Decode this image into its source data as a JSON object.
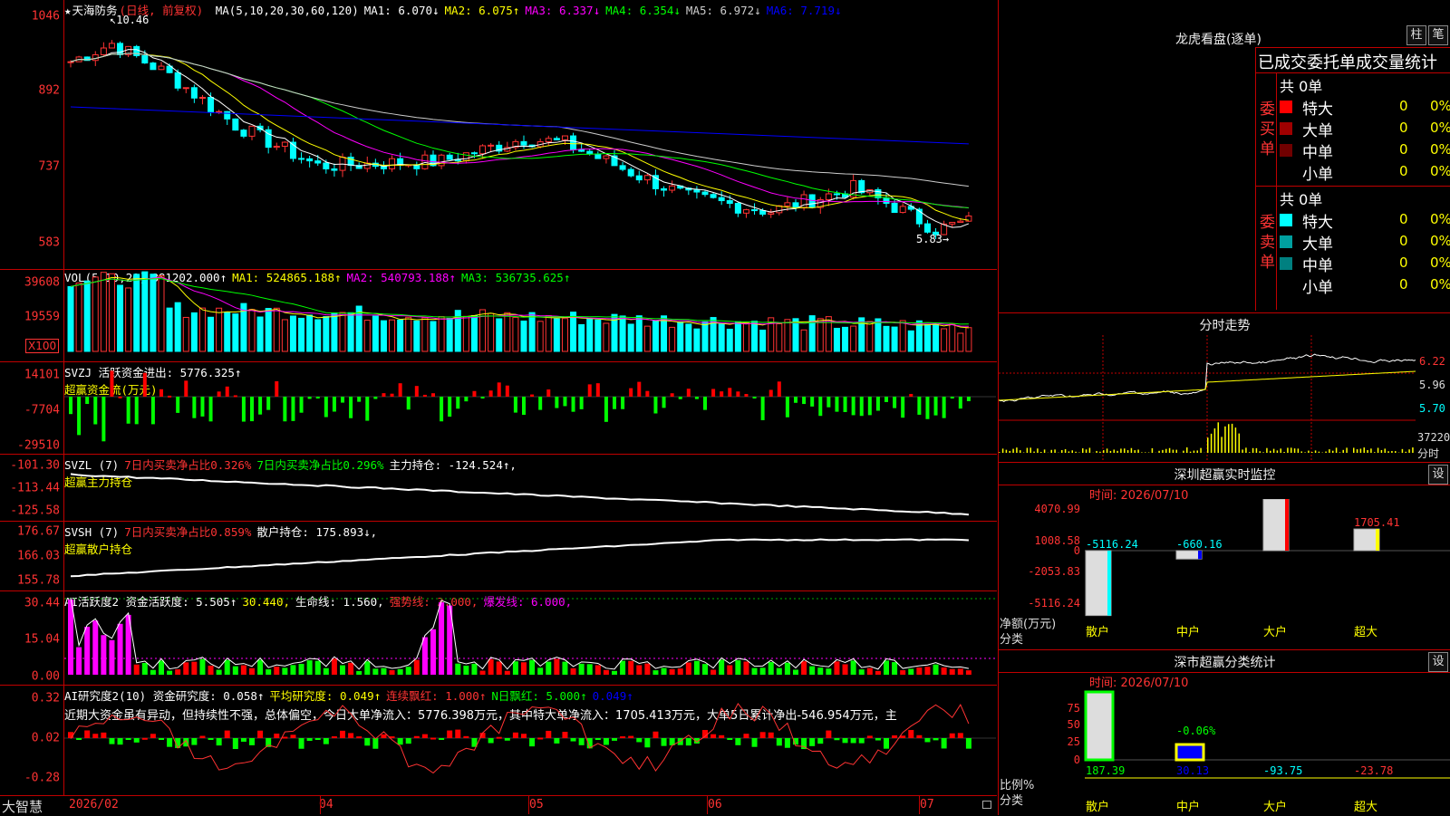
{
  "stock": {
    "name": "天海防务",
    "mode": "(日线, 前复权)",
    "star": "★"
  },
  "main": {
    "yticks": [
      "1046",
      "892",
      "737",
      "583"
    ],
    "ma": [
      {
        "label": "MA(5,10,20,30,60,120)",
        "color": "#ffffff"
      },
      {
        "label": "MA1: 6.070↓",
        "color": "#ffffff"
      },
      {
        "label": "MA2: 6.075↑",
        "color": "#ffff00"
      },
      {
        "label": "MA3: 6.337↓",
        "color": "#ff00ff"
      },
      {
        "label": "MA4: 6.354↓",
        "color": "#00ff00"
      },
      {
        "label": "MA5: 6.972↓",
        "color": "#cccccc"
      },
      {
        "label": "MA6: 7.719↓",
        "color": "#0000ff"
      }
    ],
    "high_label": "10.46",
    "low_label": "5.83→"
  },
  "vol": {
    "yticks": [
      "39608",
      "19559"
    ],
    "unit": "X100",
    "header": [
      {
        "label": "VOL(5,10,20)",
        "color": "#ffffff"
      },
      {
        "label": "881202.000↑",
        "color": "#ffffff"
      },
      {
        "label": "MA1: 524865.188↑",
        "color": "#ffff00"
      },
      {
        "label": "MA2: 540793.188↑",
        "color": "#ff00ff"
      },
      {
        "label": "MA3: 536735.625↑",
        "color": "#00ff00"
      }
    ]
  },
  "svzj": {
    "yticks": [
      "14101",
      "-7704",
      "-29510"
    ],
    "line1": [
      {
        "label": "SVZJ  活跃资金进出: 5776.325↑",
        "color": "#ffffff"
      }
    ],
    "line2": [
      {
        "label": "超赢资金流(万元)",
        "color": "#ffff00"
      }
    ]
  },
  "svzl": {
    "yticks": [
      "-101.30",
      "-113.44",
      "-125.58"
    ],
    "line1": [
      {
        "label": "SVZL (7)",
        "color": "#ffffff"
      },
      {
        "label": "7日内买卖净占比0.326%",
        "color": "#ff3333"
      },
      {
        "label": "7日内买卖净占比0.296%",
        "color": "#00ff00"
      },
      {
        "label": "主力持仓: -124.524↑,",
        "color": "#ffffff"
      }
    ],
    "line2": [
      {
        "label": "超赢主力持仓",
        "color": "#ffff00"
      }
    ]
  },
  "svsh": {
    "yticks": [
      "176.67",
      "166.03",
      "155.78"
    ],
    "line1": [
      {
        "label": "SVSH (7)",
        "color": "#ffffff"
      },
      {
        "label": "7日内买卖净占比0.859%",
        "color": "#ff3333"
      },
      {
        "label": "散户持仓: 175.893↓,",
        "color": "#ffffff"
      }
    ],
    "line2": [
      {
        "label": "超赢散户持仓",
        "color": "#ffff00"
      }
    ]
  },
  "ai_active": {
    "yticks": [
      "30.44",
      "15.04",
      "0.00"
    ],
    "line1": [
      {
        "label": "AI活跃度2 资金活跃度: 5.505↑",
        "color": "#ffffff"
      },
      {
        "label": "30.440,",
        "color": "#ffff00"
      },
      {
        "label": "生命线: 1.560,",
        "color": "#ffffff"
      },
      {
        "label": "强势线: 3.000,",
        "color": "#ff3333"
      },
      {
        "label": "爆发线: 6.000,",
        "color": "#ff00ff"
      }
    ]
  },
  "ai_research": {
    "yticks": [
      "0.32",
      "0.02",
      "-0.28"
    ],
    "line1": [
      {
        "label": "AI研究度2(10) 资金研究度: 0.058↑",
        "color": "#ffffff"
      },
      {
        "label": "平均研究度: 0.049↑",
        "color": "#ffff00"
      },
      {
        "label": "连续飘红: 1.000↑",
        "color": "#ff3333"
      },
      {
        "label": "N日飘红: 5.000↑",
        "color": "#00ff00"
      },
      {
        "label": "0.049↑",
        "color": "#0000ff"
      }
    ],
    "comment": "近期大资金虽有异动，但持续性不强，总体偏空，今日大单净流入：5776.398万元，其中特大单净流入：1705.413万元，大单5日累计净出-546.954万元，主"
  },
  "xaxis": {
    "brand": "大智慧",
    "labels": [
      "2026/02",
      "04",
      "05",
      "06",
      "07"
    ]
  },
  "longhu": {
    "title": "龙虎看盘(逐单)",
    "btn1": "柱",
    "btn2": "笔",
    "subtitle": "已成交委托单成交量统计",
    "buy": {
      "side": "委买单",
      "total": "共 0单",
      "rows": [
        {
          "label": "特大",
          "count": "0",
          "pct": "0%",
          "color": "#ff0000"
        },
        {
          "label": "大单",
          "count": "0",
          "pct": "0%",
          "color": "#a00000"
        },
        {
          "label": "中单",
          "count": "0",
          "pct": "0%",
          "color": "#700000"
        },
        {
          "label": "小单",
          "count": "0",
          "pct": "0%",
          "color": ""
        }
      ]
    },
    "sell": {
      "side": "委卖单",
      "total": "共 0单",
      "rows": [
        {
          "label": "特大",
          "count": "0",
          "pct": "0%",
          "color": "#00ffff"
        },
        {
          "label": "大单",
          "count": "0",
          "pct": "0%",
          "color": "#00a0a0"
        },
        {
          "label": "中单",
          "count": "0",
          "pct": "0%",
          "color": "#008080"
        },
        {
          "label": "小单",
          "count": "0",
          "pct": "0%",
          "color": ""
        }
      ]
    }
  },
  "fenshi": {
    "title": "分时走势",
    "yticks": [
      "6.22",
      "5.96",
      "5.70"
    ],
    "vol_label": "37220",
    "vol_unit": "分时"
  },
  "sz_monitor": {
    "title": "深圳超赢实时监控",
    "btn": "设",
    "time": "时间: 2026/07/10",
    "yticks": [
      "4070.99",
      "1008.58",
      "0",
      "-2053.83",
      "-5116.24"
    ],
    "axis_label": "净额(万元)",
    "cat_label": "分类",
    "bars": [
      {
        "cat": "散户",
        "value": -5116.24,
        "label": "-5116.24"
      },
      {
        "cat": "中户",
        "value": -660.16,
        "label": "-660.16"
      },
      {
        "cat": "大户",
        "value": 4070.99,
        "label": "4070.99"
      },
      {
        "cat": "超大",
        "value": 1705.41,
        "label": "1705.41"
      }
    ]
  },
  "sz_stats": {
    "title": "深市超赢分类统计",
    "btn": "设",
    "time": "时间: 2026/07/10",
    "yticks": [
      "75",
      "50",
      "25",
      "0"
    ],
    "axis_label": "比例%",
    "cat_label": "分类",
    "bars": [
      {
        "cat": "散户",
        "value": 187.39,
        "label": "187.39"
      },
      {
        "cat": "中户",
        "value": 30.13,
        "label": "30.13",
        "top": "-0.06%"
      },
      {
        "cat": "大户",
        "value": -93.75,
        "label": "-93.75"
      },
      {
        "cat": "超大",
        "value": -23.78,
        "label": "-23.78"
      }
    ]
  }
}
